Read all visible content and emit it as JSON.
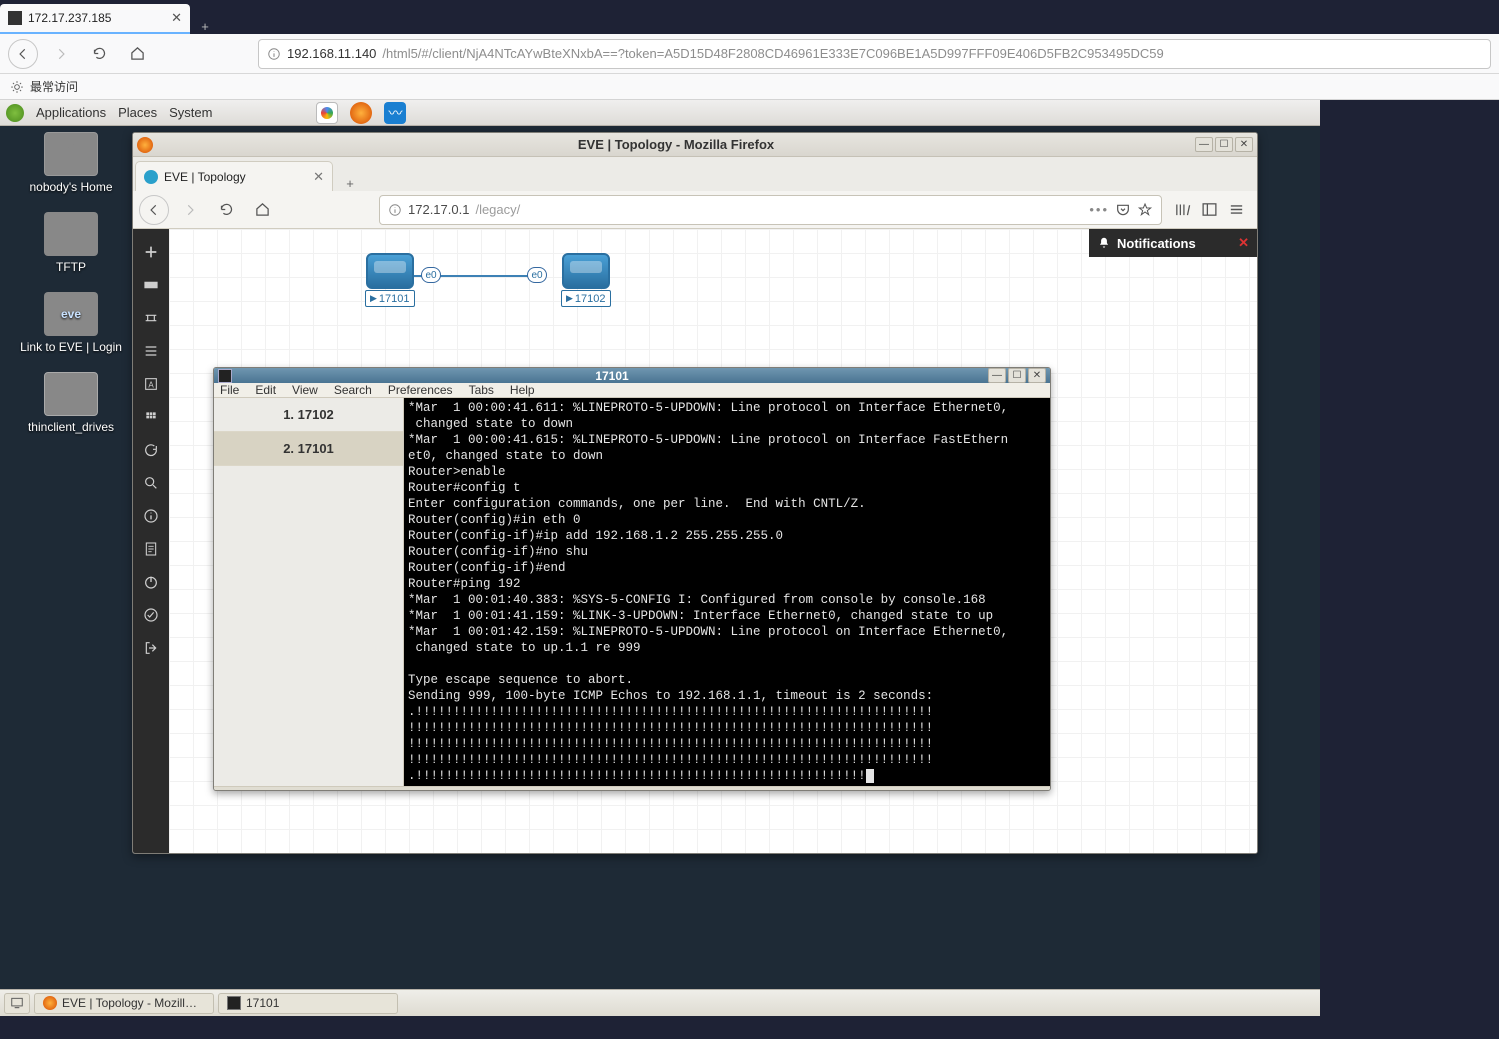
{
  "outer_browser": {
    "tab_title": "172.17.237.185",
    "url_host": "192.168.11.140",
    "url_path": "/html5/#/client/NjA4NTcAYwBteXNxbA==?token=A5D15D48F2808CD46961E333E7C096BE1A5D997FFF09E406D5FB2C953495DC59",
    "bookmark_label": "最常访问",
    "newtab_plus": "+"
  },
  "gnome": {
    "menu_applications": "Applications",
    "menu_places": "Places",
    "menu_system": "System"
  },
  "desktop_icons": {
    "home": "nobody's Home",
    "tftp": "TFTP",
    "eve": "Link to EVE | Login",
    "drives": "thinclient_drives",
    "eve_logo": "eve"
  },
  "firefox": {
    "window_title": "EVE | Topology - Mozilla Firefox",
    "tab_label": "EVE | Topology",
    "url_host": "172.17.0.1",
    "url_path": "/legacy/"
  },
  "eve": {
    "notifications_label": "Notifications",
    "node1_label": "17101",
    "node2_label": "17102",
    "port_e0": "e0"
  },
  "terminal": {
    "title": "17101",
    "menu": {
      "file": "File",
      "edit": "Edit",
      "view": "View",
      "search": "Search",
      "preferences": "Preferences",
      "tabs": "Tabs",
      "help": "Help"
    },
    "tab1": "1. 17102",
    "tab2": "2. 17101",
    "output": "*Mar  1 00:00:41.611: %LINEPROTO-5-UPDOWN: Line protocol on Interface Ethernet0,\n changed state to down\n*Mar  1 00:00:41.615: %LINEPROTO-5-UPDOWN: Line protocol on Interface FastEthern\net0, changed state to down\nRouter>enable\nRouter#config t\nEnter configuration commands, one per line.  End with CNTL/Z.\nRouter(config)#in eth 0\nRouter(config-if)#ip add 192.168.1.2 255.255.255.0\nRouter(config-if)#no shu\nRouter(config-if)#end\nRouter#ping 192\n*Mar  1 00:01:40.383: %SYS-5-CONFIG I: Configured from console by console.168\n*Mar  1 00:01:41.159: %LINK-3-UPDOWN: Interface Ethernet0, changed state to up\n*Mar  1 00:01:42.159: %LINEPROTO-5-UPDOWN: Line protocol on Interface Ethernet0,\n changed state to up.1.1 re 999\n\nType escape sequence to abort.\nSending 999, 100-byte ICMP Echos to 192.168.1.1, timeout is 2 seconds:\n.!!!!!!!!!!!!!!!!!!!!!!!!!!!!!!!!!!!!!!!!!!!!!!!!!!!!!!!!!!!!!!!!!!!!!\n!!!!!!!!!!!!!!!!!!!!!!!!!!!!!!!!!!!!!!!!!!!!!!!!!!!!!!!!!!!!!!!!!!!!!!\n!!!!!!!!!!!!!!!!!!!!!!!!!!!!!!!!!!!!!!!!!!!!!!!!!!!!!!!!!!!!!!!!!!!!!!\n!!!!!!!!!!!!!!!!!!!!!!!!!!!!!!!!!!!!!!!!!!!!!!!!!!!!!!!!!!!!!!!!!!!!!!\n.!!!!!!!!!!!!!!!!!!!!!!!!!!!!!!!!!!!!!!!!!!!!!!!!!!!!!!!!!!!!"
  },
  "taskbar": {
    "task_firefox": "EVE | Topology - Mozill…",
    "task_terminal": "17101"
  }
}
